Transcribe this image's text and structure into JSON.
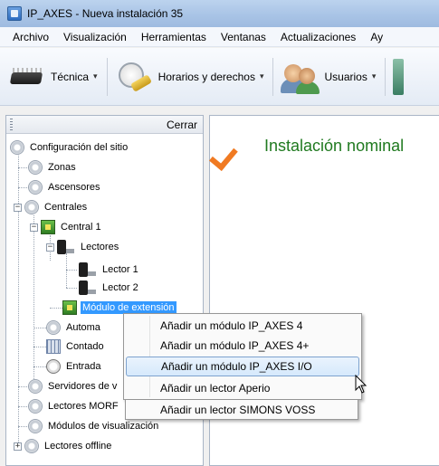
{
  "window": {
    "title": "IP_AXES - Nueva instalación 35"
  },
  "menu": [
    "Archivo",
    "Visualización",
    "Herramientas",
    "Ventanas",
    "Actualizaciones",
    "Ay"
  ],
  "toolbar": {
    "tecnica": "Técnica",
    "horarios": "Horarios y derechos",
    "usuarios": "Usuarios",
    "dropdown_glyph": "▾"
  },
  "panel": {
    "close_label": "Cerrar"
  },
  "tree": {
    "root": "Configuración del sitio",
    "zonas": "Zonas",
    "ascensores": "Ascensores",
    "centrales": "Centrales",
    "central1": "Central 1",
    "lectores": "Lectores",
    "lector1": "Lector 1",
    "lector2": "Lector 2",
    "modulo": "Módulo de extensión",
    "automa": "Automa",
    "contado": "Contado",
    "entrada": "Entrada",
    "servidores": "Servidores de v",
    "lectores_morf": "Lectores MORF",
    "modulos_vis": "Módulos de visualización",
    "lectores_offline": "Lectores offline",
    "minus": "−",
    "plus": "+"
  },
  "main": {
    "status": "Instalación nominal"
  },
  "context_menu": [
    "Añadir un módulo IP_AXES 4",
    "Añadir un módulo IP_AXES 4+",
    "Añadir un módulo IP_AXES I/O",
    "Añadir un lector Aperio",
    "Añadir un lector SIMONS VOSS"
  ],
  "colors": {
    "selection": "#3399ff",
    "status_green": "#207a20",
    "check_orange": "#f07a22"
  }
}
